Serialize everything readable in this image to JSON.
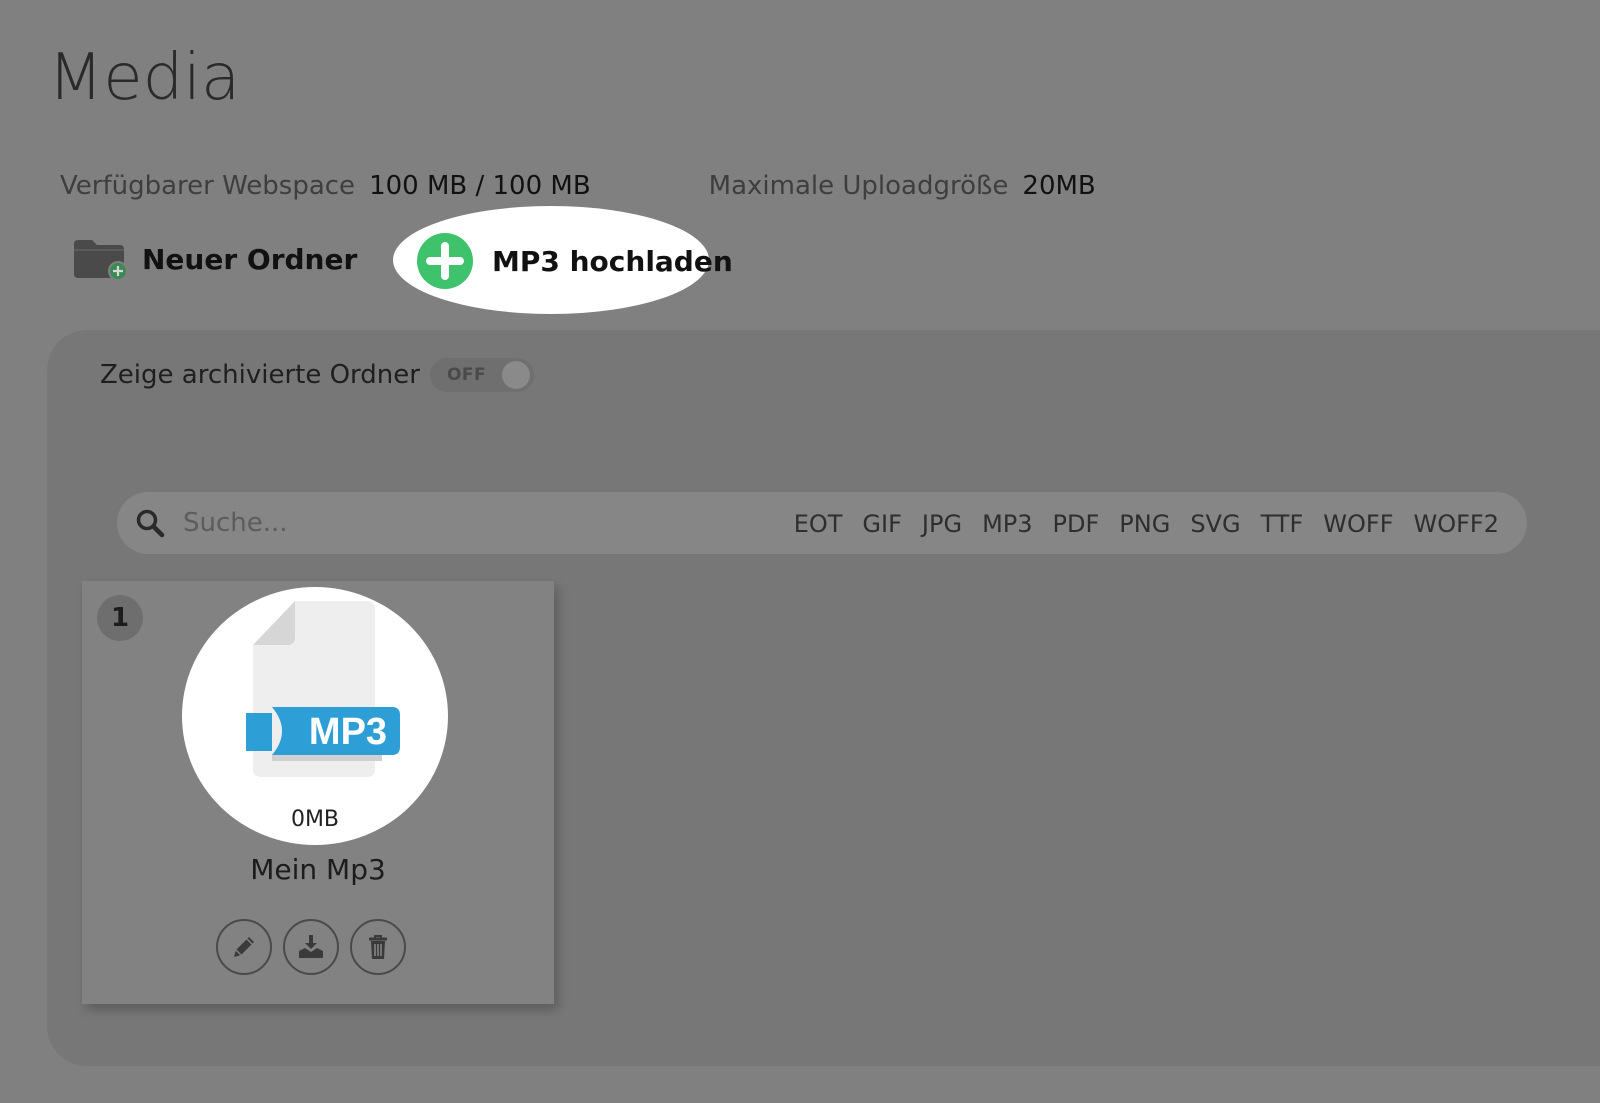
{
  "page": {
    "title": "Media"
  },
  "stats": {
    "webspace_label": "Verfügbarer Webspace",
    "webspace_value": "100 MB / 100 MB",
    "upload_label": "Maximale Uploadgröße",
    "upload_value": "20MB"
  },
  "actions": {
    "new_folder_label": "Neuer Ordner",
    "upload_label": "MP3 hochladen"
  },
  "archived": {
    "label": "Zeige archivierte Ordner",
    "toggle_state": "OFF"
  },
  "search": {
    "placeholder": "Suche...",
    "filters": [
      "EOT",
      "GIF",
      "JPG",
      "MP3",
      "PDF",
      "PNG",
      "SVG",
      "TTF",
      "WOFF",
      "WOFF2"
    ]
  },
  "files": [
    {
      "index": "1",
      "badge": "MP3",
      "size": "0MB",
      "name": "Mein Mp3"
    }
  ],
  "colors": {
    "accent_green": "#3ec26b",
    "mp3_blue": "#2e9fd6",
    "overlay_gray": "#808080"
  },
  "icons": {
    "new_folder": "folder-plus-icon",
    "upload": "plus-circle-icon",
    "search": "search-icon",
    "edit": "pencil-icon",
    "download": "download-icon",
    "delete": "trash-icon"
  }
}
